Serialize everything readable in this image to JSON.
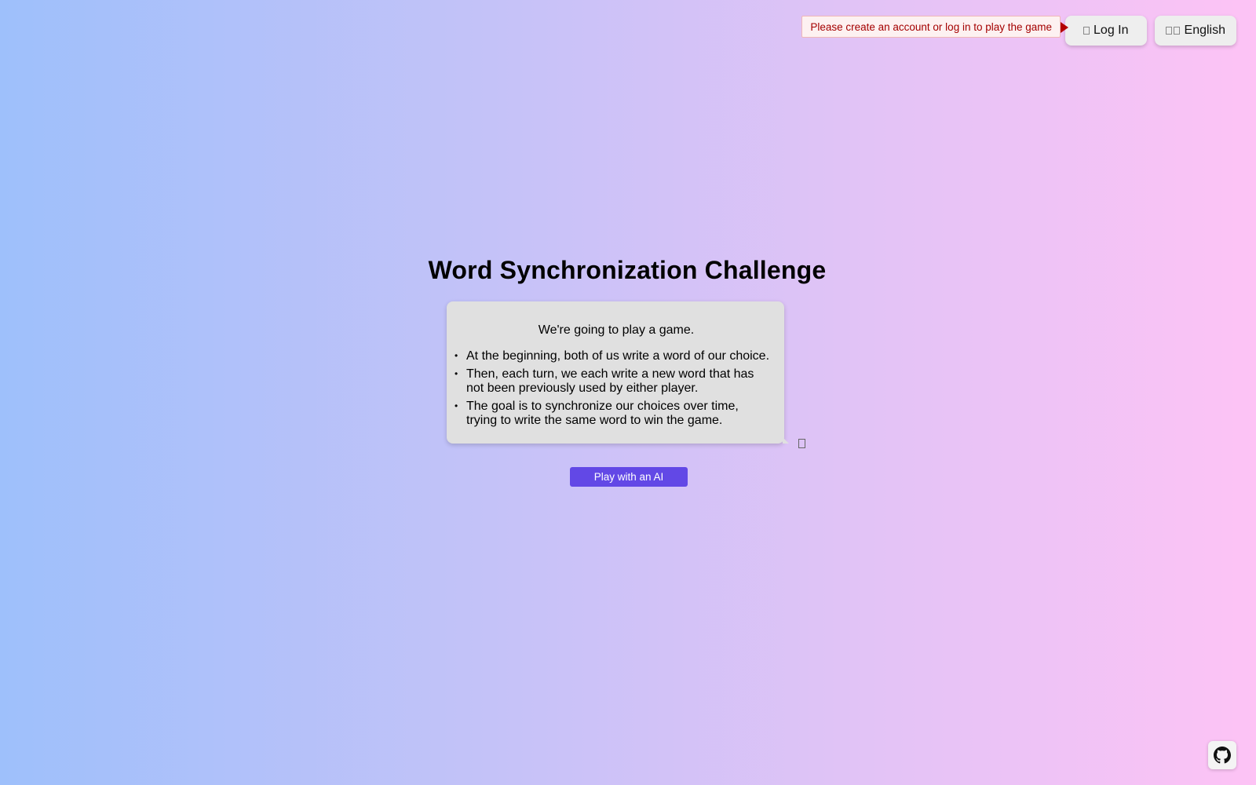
{
  "header": {
    "alert_text": "Please create an account or log in to play the game",
    "login_label": "Log In",
    "login_icon": "user-icon",
    "language_label": "English",
    "language_icon": "flag-icon"
  },
  "main": {
    "title": "Word Synchronization Challenge",
    "intro": "We're going to play a game.",
    "rules": [
      "At the beginning, both of us write a word of our choice.",
      "Then, each turn, we each write a new word that has not been previously used by either player.",
      "The goal is to synchronize our choices over time, trying to write the same word to win the game."
    ],
    "speaker_icon": "speaker-icon",
    "play_button": "Play with an AI"
  },
  "footer": {
    "github_icon": "github-icon"
  },
  "colors": {
    "accent": "#6248e6",
    "alert_text": "#a40000",
    "card_bg": "#e0e0e0"
  }
}
